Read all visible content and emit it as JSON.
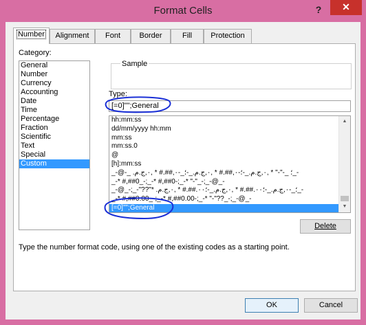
{
  "window": {
    "title": "Format Cells",
    "help": "?",
    "close": "✕"
  },
  "tabs": [
    {
      "label": "Number",
      "active": true
    },
    {
      "label": "Alignment",
      "active": false
    },
    {
      "label": "Font",
      "active": false
    },
    {
      "label": "Border",
      "active": false
    },
    {
      "label": "Fill",
      "active": false
    },
    {
      "label": "Protection",
      "active": false
    }
  ],
  "category": {
    "label": "Category:",
    "items": [
      "General",
      "Number",
      "Currency",
      "Accounting",
      "Date",
      "Time",
      "Percentage",
      "Fraction",
      "Scientific",
      "Text",
      "Special",
      "Custom"
    ],
    "selected": "Custom"
  },
  "sample": {
    "label": "Sample",
    "value": ""
  },
  "type": {
    "label": "Type:",
    "value": "[=0]\"\";General"
  },
  "formats": [
    "hh:mm:ss",
    "dd/mm/yyyy hh:mm",
    "mm:ss",
    "mm:ss.0",
    "@",
    "[h]:mm:ss",
    "_-@-_ ؛ _-\"-\" * ,٠,ج.م.‏_-؛-٠,##.# * ,٠,ج.م.‏_-؛_-٠,##.# * ,٠,ج.م.‏_-",
    "_-* #,##0_-;_-* #,##0-;_-* \"-\"_-;_-@_-",
    "_-@_-;_-\"??\"* ؛_-٠,ج.م.‏_-؛٠٠.##.# * ,٠,ج.م.‏_-؛٠٠.##.# * ,٠,ج.م.‏_-",
    "_-* #,##0.00_-;_-* #,##0.00-;_-* \"-\"??_-;_-@_-",
    "[=0]\"\";General"
  ],
  "selected_format": "[=0]\"\";General",
  "buttons": {
    "delete": "Delete",
    "ok": "OK",
    "cancel": "Cancel"
  },
  "description": "Type the number format code, using one of the existing codes as a starting point.",
  "colors": {
    "titlebar": "#d86ea3",
    "close_button": "#c7312b",
    "selection": "#3399ff",
    "annotation": "#1a2fd6"
  },
  "icons": {
    "scroll_up": "▲",
    "scroll_down": "▼"
  }
}
